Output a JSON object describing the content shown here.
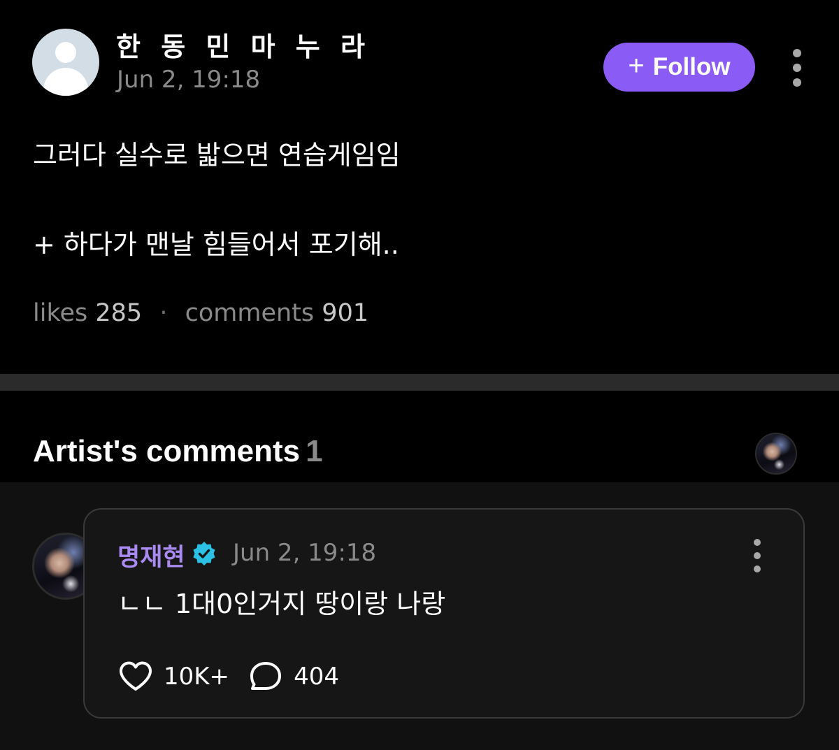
{
  "post": {
    "author_name": "한 동 민  마 누 라",
    "timestamp": "Jun 2, 19:18",
    "follow_label": "Follow",
    "body_line_1": "그러다 실수로 밟으면 연습게임임",
    "body_line_2": "+ 하다가 맨날 힘들어서 포기해..",
    "likes_label": "likes",
    "likes_count": "285",
    "comments_label": "comments",
    "comments_count": "901"
  },
  "artist_comments": {
    "title": "Artist's comments",
    "count": "1",
    "comment": {
      "author": "명재현",
      "verified": true,
      "timestamp": "Jun 2, 19:18",
      "text": "ㄴㄴ 1대0인거지 땅이랑 나랑",
      "likes": "10K+",
      "replies": "404"
    }
  },
  "icons": {
    "avatar": "user-silhouette-icon",
    "plus": "plus-icon",
    "more": "vertical-ellipsis-icon",
    "verified": "verified-badge-icon",
    "like": "heart-outline-icon",
    "reply": "speech-bubble-icon"
  },
  "colors": {
    "background": "#000000",
    "accent": "#8a5cf5",
    "artist_name": "#a98af0",
    "verified_badge": "#2bc0e4",
    "muted_text": "#8a8a8a",
    "comment_area": "#111111"
  }
}
